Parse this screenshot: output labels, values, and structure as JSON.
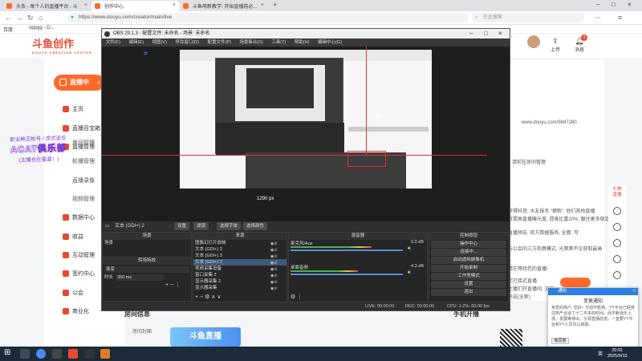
{
  "browser": {
    "tabs": [
      {
        "label": "头条 - 每个人的直播平台 - 斗",
        "active": false
      },
      {
        "label": "创作中心",
        "active": true
      },
      {
        "label": "斗鱼萌新教学: 开始直播前必...",
        "active": false
      }
    ],
    "url": "https://www.douyu.com/creator/main/live",
    "search_placeholder": "在此搜索",
    "bookmarks": [
      "百度",
      "oppgg - O..."
    ]
  },
  "page": {
    "logo": "斗鱼创作",
    "logo_sub": "DOUYU CREATION CENTER",
    "live_button": "直播中",
    "nav": [
      {
        "label": "主页",
        "type": "main"
      },
      {
        "label": "直播百宝箱",
        "type": "main"
      },
      {
        "label": "直播管理",
        "type": "main"
      },
      {
        "label": "房间管理",
        "type": "sub"
      },
      {
        "label": "轮播管理",
        "type": "sub"
      },
      {
        "label": "直播录像",
        "type": "sub"
      },
      {
        "label": "视频管理",
        "type": "sub"
      },
      {
        "label": "数据中心",
        "type": "main"
      },
      {
        "label": "收益",
        "type": "main"
      },
      {
        "label": "互动管理",
        "type": "main"
      },
      {
        "label": "签约中心",
        "type": "main"
      },
      {
        "label": "公会",
        "type": "main"
      },
      {
        "label": "商业化",
        "type": "main"
      }
    ],
    "promo_line1": "职业韩王帐号 / 虎式逆反",
    "promo_big": "ACAT俱乐部",
    "promo_line3": "(主播也在里面！)",
    "upload_label": "上传",
    "messages_label": "消息",
    "messages_badge": "3",
    "right_texts": [
      "www.douyu.com/9847280",
      "请前往房间管理",
      "获得抖音, 水友报名 “撩粉”, 他们其他直播",
      "可提高直播曝光度, 提高比重20%, 跟住更多稳定",
      "直播预告, 官方数据服务, 全面, 可",
      "与公会的三方和携模式, 光第第不论获取最高",
      "请在等待您的直播!",
      "您已接近直播",
      "主播们开直播间, 文字,",
      "开启(全新)"
    ],
    "tools_label": "礼物直播",
    "bottom_left": "房间信息",
    "bottom_left_sub": "房间封面",
    "bottom_mid": "手机开播",
    "live_promo": "斗鱼直播"
  },
  "obs": {
    "title": "OBS 29.1.3 - 配置文件: 未命名 - 场景: 未命名",
    "menu": [
      "文件(F)",
      "编辑(E)",
      "视图(V)",
      "停靠窗口(D)",
      "配置文件(P)",
      "场景集合(S)",
      "工具(T)",
      "帮助(H)",
      "编辑中心(G)"
    ],
    "preview_label_1": "767 px",
    "preview_label_2": "1290 px",
    "source_selected": "文本 (GDI+) 2",
    "toolbar_buttons": [
      "设置",
      "滤镜",
      "选择字体",
      "选择颜色"
    ],
    "docks": {
      "scenes_title": "场景",
      "scenes": [
        "场景"
      ],
      "sources_title": "来源",
      "sources": [
        "图像幻灯片放映",
        "文本 (GDI+) 3",
        "文本 (GDI+) 3",
        "文本 (GDI+) 2",
        "视频采集设备",
        "窗口采集 2",
        "显示器采集 2",
        "显示器采集"
      ],
      "transitions_title": "转场特效",
      "transition_type": "渐变",
      "duration_label": "时长",
      "duration_value": "350 ms",
      "mixer_title": "混音器",
      "mixer": [
        {
          "name": "麦克风/Aux",
          "db": "0.0 dB",
          "level": 0.72
        },
        {
          "name": "桌面音频",
          "db": "-4.3 dB",
          "level": 0.6
        }
      ],
      "controls_title": "控制按钮",
      "controls": [
        "操作中心",
        "连接中...",
        "启动虚拟摄像机",
        "开始录制",
        "工作室模式",
        "设置",
        "退出"
      ]
    },
    "status": {
      "live": "LIVE: 00:00:00",
      "rec": "REC: 00:00:00",
      "cpu": "CPU: 1.2%, 60.00 fps"
    }
  },
  "notification": {
    "header": "通知",
    "title": "变更通知",
    "body": "亲爱的用户, 您好~ 方招不胜爽。YY平台已经排往所产合适了十二平本的时间。而不断涨价上涨，发展等待出，引领直播前流，一直要YY平台和YY人员页以获取。",
    "ok_button": "我同意"
  },
  "taskbar": {
    "time": "20:01",
    "date": "2025/9/10",
    "ime": "英"
  }
}
